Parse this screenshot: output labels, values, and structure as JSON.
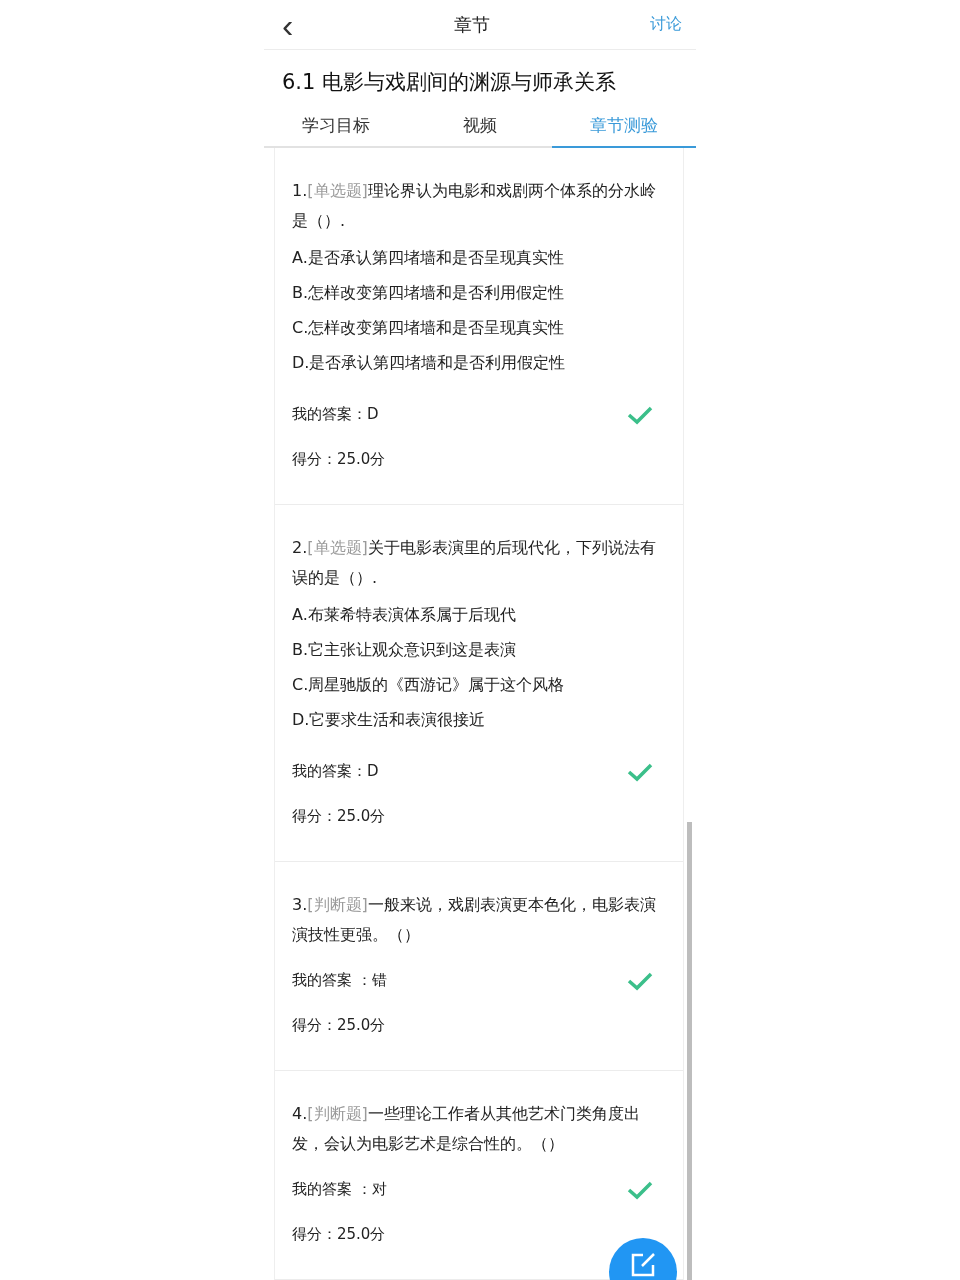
{
  "nav": {
    "back": "‹",
    "title": "章节",
    "action": "讨论"
  },
  "chapter_title": "6.1 电影与戏剧间的渊源与师承关系",
  "tabs": [
    {
      "label": "学习目标",
      "selected": false
    },
    {
      "label": "视频",
      "selected": false
    },
    {
      "label": "章节测验",
      "selected": true
    }
  ],
  "questions": [
    {
      "number": "1.",
      "tag": "[单选题]",
      "text": "理论界认为电影和戏剧两个体系的分水岭是（）.",
      "options": [
        "A.是否承认第四堵墙和是否呈现真实性",
        "B.怎样改变第四堵墙和是否利用假定性",
        "C.怎样改变第四堵墙和是否呈现真实性",
        "D.是否承认第四堵墙和是否利用假定性"
      ],
      "answer": "我的答案：D",
      "correct": true,
      "score": "得分：25.0分"
    },
    {
      "number": "2.",
      "tag": "[单选题]",
      "text": "关于电影表演里的后现代化，下列说法有误的是（）.",
      "options": [
        "A.布莱希特表演体系属于后现代",
        "B.它主张让观众意识到这是表演",
        "C.周星驰版的《西游记》属于这个风格",
        "D.它要求生活和表演很接近"
      ],
      "answer": "我的答案：D",
      "correct": true,
      "score": "得分：25.0分"
    },
    {
      "number": "3.",
      "tag": "[判断题]",
      "text": "一般来说，戏剧表演更本色化，电影表演演技性更强。（）",
      "answer": "我的答案 ：错",
      "correct": true,
      "score": "得分：25.0分"
    },
    {
      "number": "4.",
      "tag": "[判断题]",
      "text": "一些理论工作者从其他艺术门类角度出发，会认为电影艺术是综合性的。（）",
      "answer": "我的答案 ：对",
      "correct": true,
      "score": "得分：25.0分"
    }
  ]
}
